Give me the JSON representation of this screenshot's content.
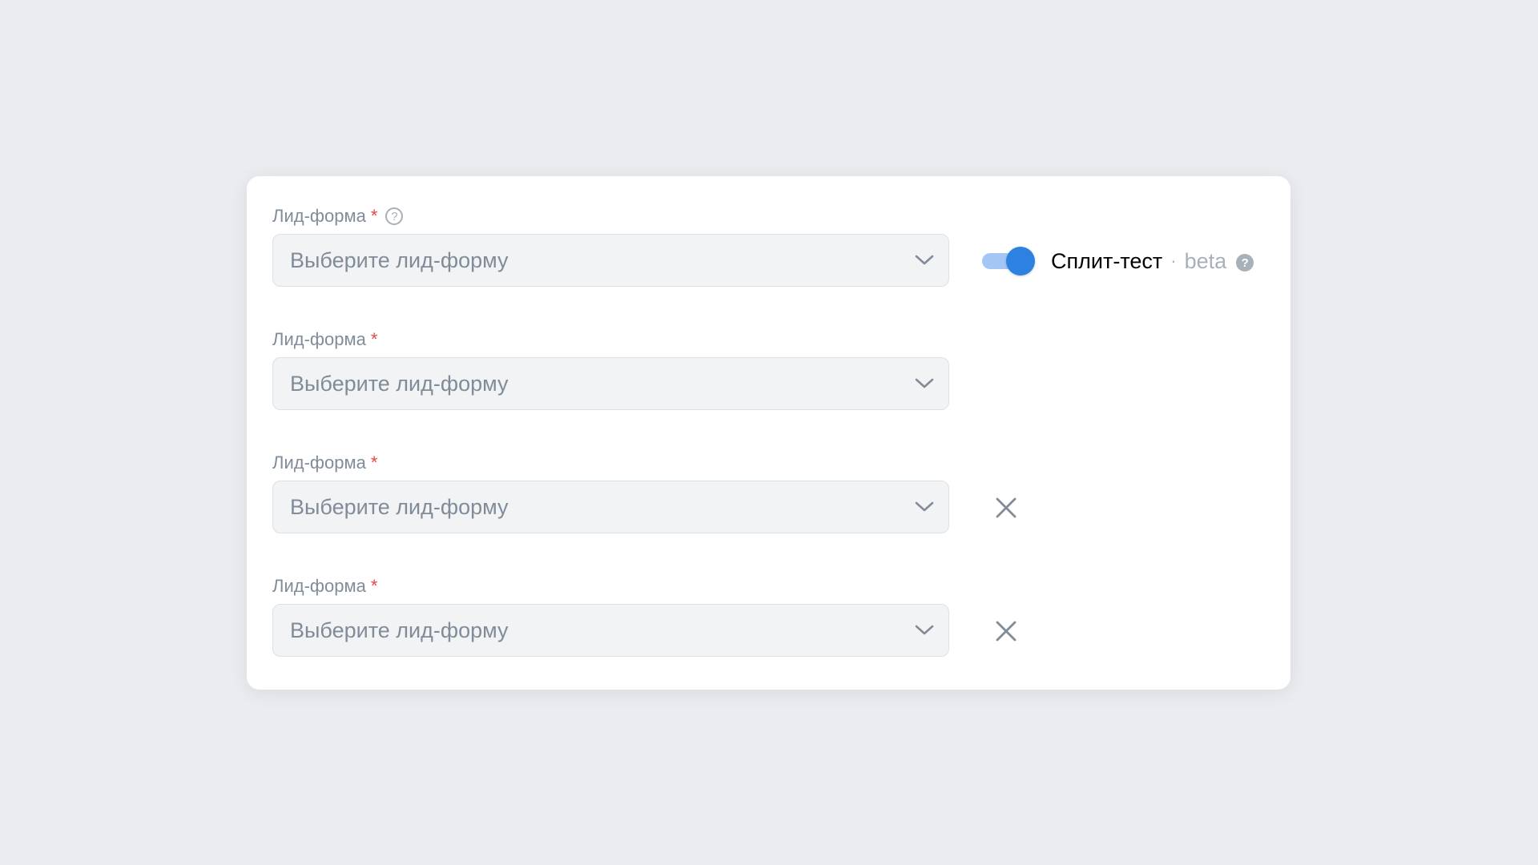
{
  "fields": [
    {
      "label": "Лид-форма",
      "required_mark": "*",
      "help_glyph": "?",
      "placeholder": "Выберите лид-форму",
      "removable": false
    },
    {
      "label": "Лид-форма",
      "required_mark": "*",
      "placeholder": "Выберите лид-форму",
      "removable": false
    },
    {
      "label": "Лид-форма",
      "required_mark": "*",
      "placeholder": "Выберите лид-форму",
      "removable": true
    },
    {
      "label": "Лид-форма",
      "required_mark": "*",
      "placeholder": "Выберите лид-форму",
      "removable": true
    }
  ],
  "split_test": {
    "label": "Сплит-тест",
    "separator": "·",
    "badge": "beta",
    "help_glyph": "?",
    "enabled": true
  },
  "colors": {
    "accent": "#2d81e0",
    "toggle_track": "#a3c6f5",
    "required": "#e64646",
    "muted_text": "#818c99",
    "field_background": "#f2f3f5",
    "page_background": "#ebecf0"
  },
  "icons": {
    "dropdown": "chevron-down-icon",
    "remove": "close-icon",
    "help": "question-circle-icon"
  }
}
